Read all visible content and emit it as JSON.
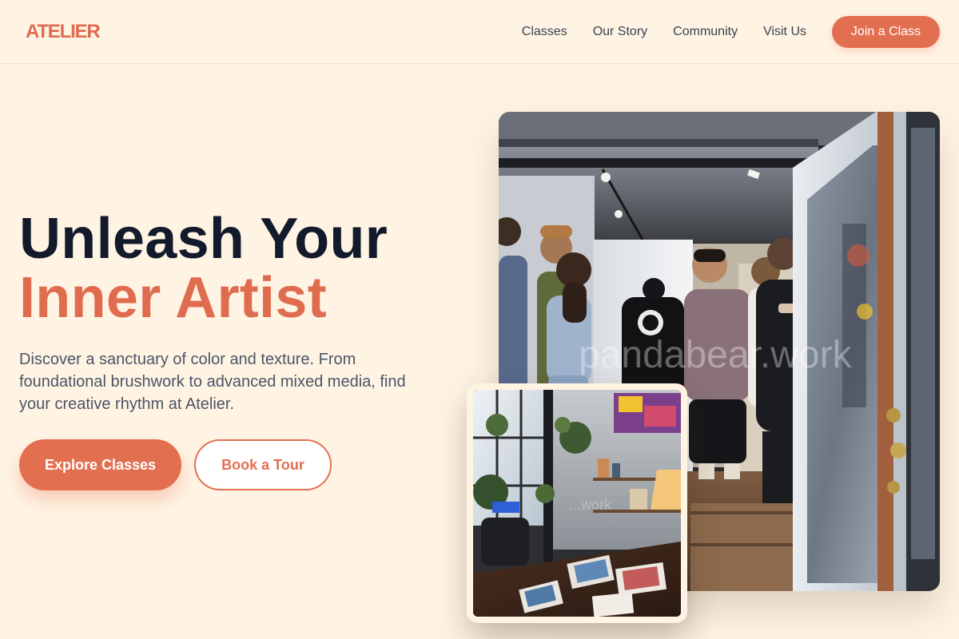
{
  "header": {
    "logo": "ATELIER",
    "nav": [
      "Classes",
      "Our Story",
      "Community",
      "Visit Us"
    ],
    "cta": "Join a Class"
  },
  "hero": {
    "headline_line1": "Unleash Your",
    "headline_line2": "Inner Artist",
    "description": "Discover a sanctuary of color and texture. From foundational brushwork to advanced mixed media, find your creative rhythm at Atelier.",
    "primary_button": "Explore Classes",
    "secondary_button": "Book a Tour"
  },
  "images": {
    "main_photo": "gallery-opening-crowd-photo",
    "inset_photo": "art-studio-desk-photo",
    "main_watermark": "pandabear.work",
    "inset_watermark": "...work"
  },
  "colors": {
    "background": "#fff4e4",
    "accent": "#e36f51",
    "headline_dark": "#131a2c",
    "body_text": "#4b5466"
  }
}
